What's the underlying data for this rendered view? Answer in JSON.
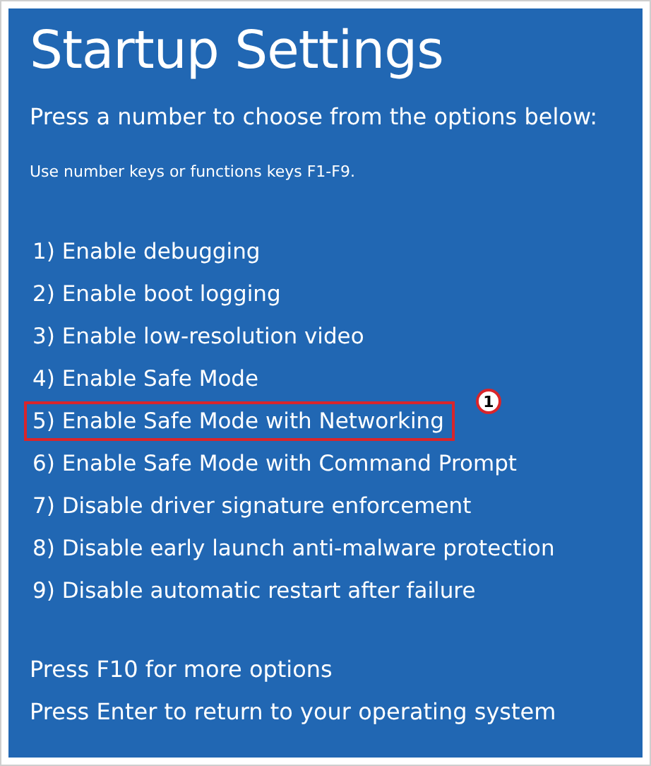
{
  "title": "Startup Settings",
  "prompt": "Press a number to choose from the options below:",
  "hint": "Use number keys or functions keys F1-F9.",
  "options": [
    {
      "label": "1) Enable debugging",
      "highlighted": false
    },
    {
      "label": "2) Enable boot logging",
      "highlighted": false
    },
    {
      "label": "3) Enable low-resolution video",
      "highlighted": false
    },
    {
      "label": "4) Enable Safe Mode",
      "highlighted": false
    },
    {
      "label": "5) Enable Safe Mode with Networking",
      "highlighted": true,
      "badge": "1"
    },
    {
      "label": "6) Enable Safe Mode with Command Prompt",
      "highlighted": false
    },
    {
      "label": "7) Disable driver signature enforcement",
      "highlighted": false
    },
    {
      "label": "8) Disable early launch anti-malware protection",
      "highlighted": false
    },
    {
      "label": "9) Disable automatic restart after failure",
      "highlighted": false
    }
  ],
  "footer": [
    "Press F10 for more options",
    "Press Enter to return to your operating system"
  ]
}
